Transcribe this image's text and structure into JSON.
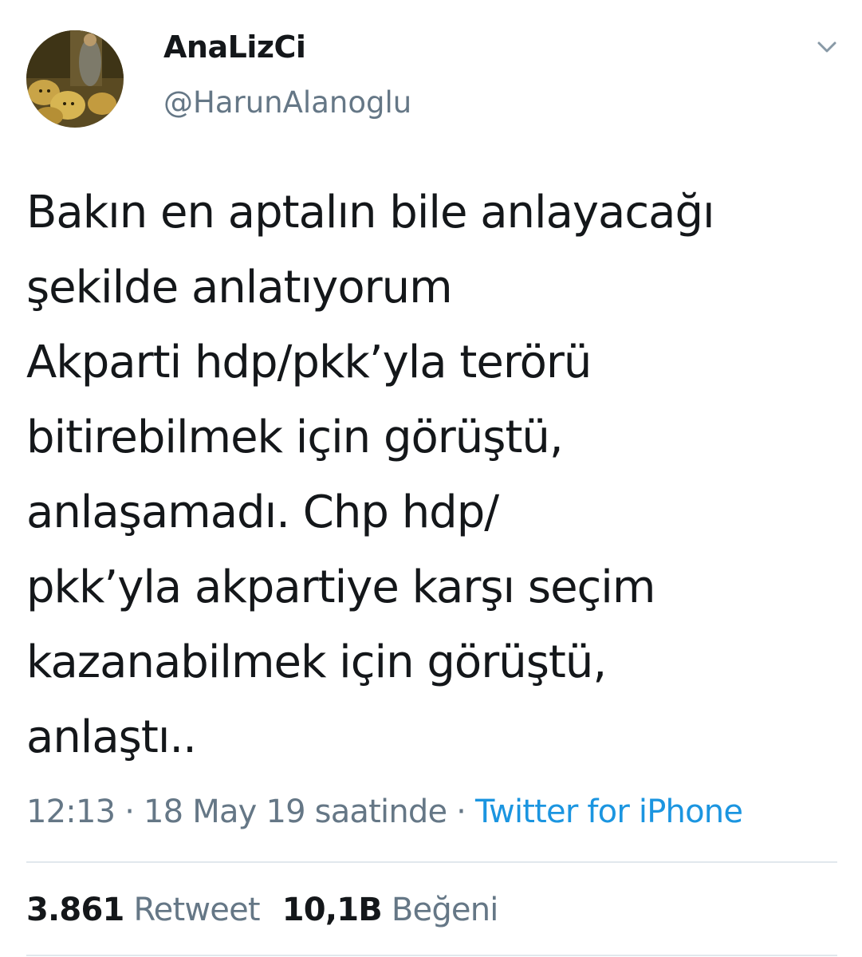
{
  "profile": {
    "display_name": "AnaLizCi",
    "handle": "@HarunAlanoglu"
  },
  "icons": {
    "avatar": "avatar-lions-painting",
    "menu": "chevron-down-icon"
  },
  "tweet": {
    "lines": [
      "Bakın en aptalın bile anlayacağı",
      "şekilde anlatıyorum",
      "Akparti hdp/pkk’yla terörü",
      "bitirebilmek için görüştü,",
      "anlaşamadı. Chp hdp/",
      "pkk’yla akpartiye karşı seçim",
      "kazanabilmek için görüştü,",
      "anlaştı.."
    ]
  },
  "meta": {
    "timestamp": "12:13 · 18 May 19 saatinde · ",
    "source": "Twitter for iPhone"
  },
  "stats": {
    "retweet_count": "3.861",
    "retweet_label": "Retweet",
    "like_count": "10,1B",
    "like_label": "Beğeni"
  },
  "colors": {
    "text": "#14171a",
    "secondary": "#657786",
    "link": "#1b95e0",
    "divider": "#e1e8ed"
  }
}
